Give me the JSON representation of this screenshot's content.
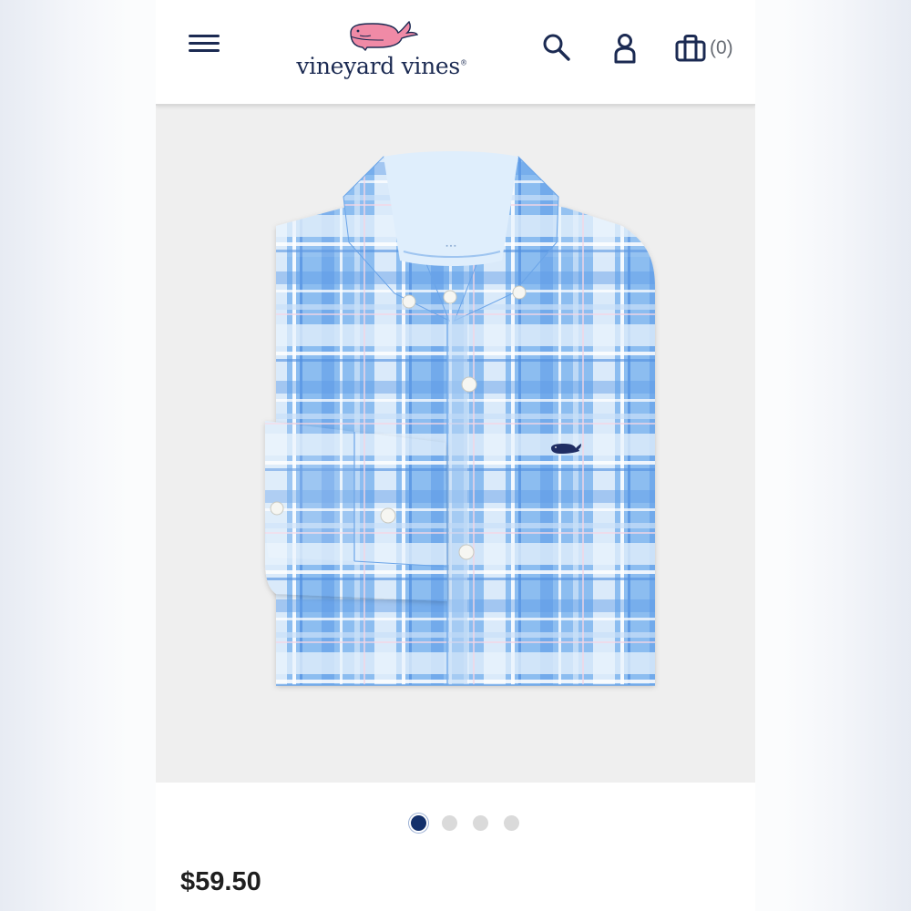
{
  "header": {
    "brand_name": "vineyard vines",
    "bag_count": "(0)"
  },
  "icons": {
    "menu": "hamburger-menu-icon",
    "search": "search-icon",
    "account": "user-icon",
    "bag": "shopping-bag-icon",
    "logo": "pink-whale-logo"
  },
  "product": {
    "image_alt": "Blue plaid long sleeve button-down shirt",
    "price": "$59.50"
  },
  "carousel": {
    "count": 4,
    "active_index": 0
  },
  "colors": {
    "navy": "#1b2a52",
    "whale_pink": "#f08aa6",
    "active_dot": "#13306b",
    "shirt_blue": "#7fb4ec"
  }
}
